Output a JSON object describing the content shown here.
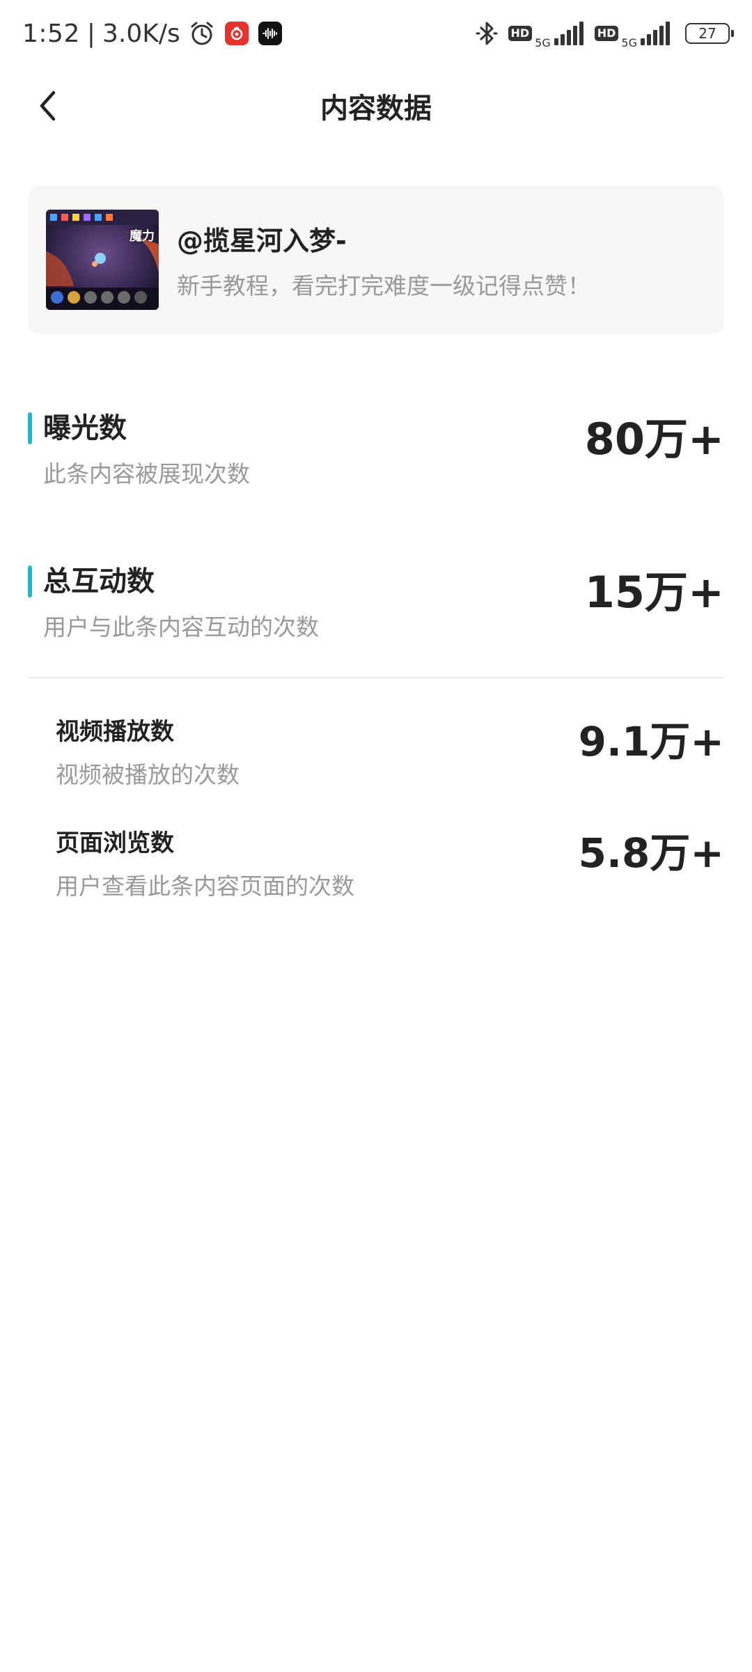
{
  "status_bar": {
    "time": "1:52",
    "separator": "|",
    "speed": "3.0K/s",
    "icons": [
      "alarm-icon",
      "netease-music-icon",
      "music-app-icon",
      "bluetooth-icon",
      "hd-icon",
      "signal-icon",
      "battery-icon"
    ],
    "hd_label_1": "HD",
    "net_label_1": "5G",
    "hd_label_2": "HD",
    "net_label_2": "5G",
    "battery_level": "27"
  },
  "header": {
    "title": "内容数据",
    "back_icon": "chevron-left-icon"
  },
  "content_card": {
    "author": "@揽星河入梦-",
    "description": "新手教程，看完打完难度一级记得点赞！",
    "thumbnail_overlay": "魔力"
  },
  "metrics": [
    {
      "name": "曝光数",
      "desc": "此条内容被展现次数",
      "value": "80万+"
    },
    {
      "name": "总互动数",
      "desc": "用户与此条内容互动的次数",
      "value": "15万+"
    }
  ],
  "submetrics": [
    {
      "name": "视频播放数",
      "desc": "视频被播放的次数",
      "value": "9.1万+"
    },
    {
      "name": "页面浏览数",
      "desc": "用户查看此条内容页面的次数",
      "value": "5.8万+"
    }
  ],
  "colors": {
    "accent": "#26b5c8",
    "card_bg": "#f7f7f7",
    "secondary_text": "#999999",
    "primary_text": "#222222"
  }
}
